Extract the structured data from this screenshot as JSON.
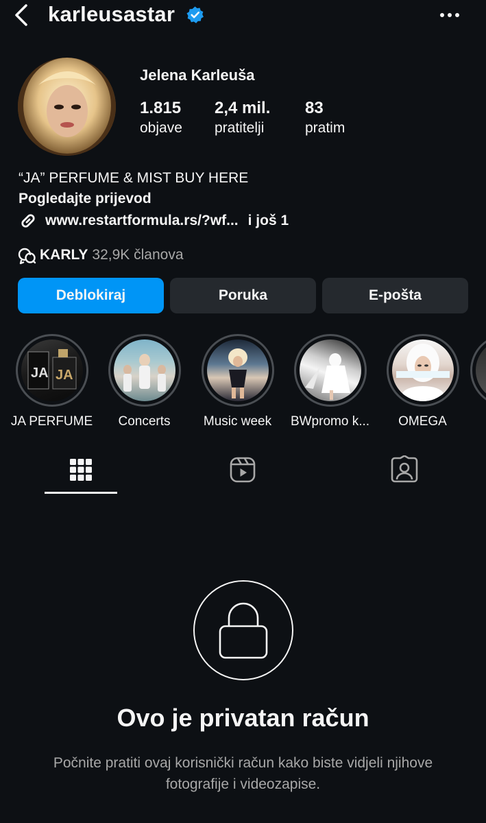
{
  "header": {
    "username": "karleusastar",
    "verified": true,
    "back_icon": "chevron-left-icon",
    "more_icon": "more-horizontal-icon"
  },
  "profile": {
    "display_name": "Jelena Karleuša",
    "stats": [
      {
        "value": "1.815",
        "label": "objave"
      },
      {
        "value": "2,4 mil.",
        "label": "pratitelji"
      },
      {
        "value": "83",
        "label": "pratim"
      }
    ],
    "bio": "“JA” PERFUME & MIST BUY HERE",
    "translate": "Pogledajte prijevod",
    "link": {
      "text": "www.restartformula.rs/?wf...",
      "more": "i još 1"
    },
    "channel": {
      "name": "KARLY",
      "members": "32,9K članova"
    }
  },
  "buttons": {
    "unblock": "Deblokiraj",
    "message": "Poruka",
    "email": "E-pošta"
  },
  "highlights": [
    {
      "label": "JA PERFUME"
    },
    {
      "label": "Concerts"
    },
    {
      "label": "Music week"
    },
    {
      "label": "BWpromo k..."
    },
    {
      "label": "OMEGA"
    }
  ],
  "tabs": [
    {
      "icon": "grid-icon",
      "active": true
    },
    {
      "icon": "reels-icon",
      "active": false
    },
    {
      "icon": "tagged-icon",
      "active": false
    }
  ],
  "private": {
    "title": "Ovo je privatan račun",
    "subtitle": "Počnite pratiti ovaj korisnički račun kako biste vidjeli njihove fotografije i videozapise."
  },
  "colors": {
    "background": "#0d1014",
    "primary_button": "#0095f6",
    "secondary_button": "#25292e",
    "verified_badge": "#1d9bf0",
    "muted_text": "#a8a8a8"
  }
}
